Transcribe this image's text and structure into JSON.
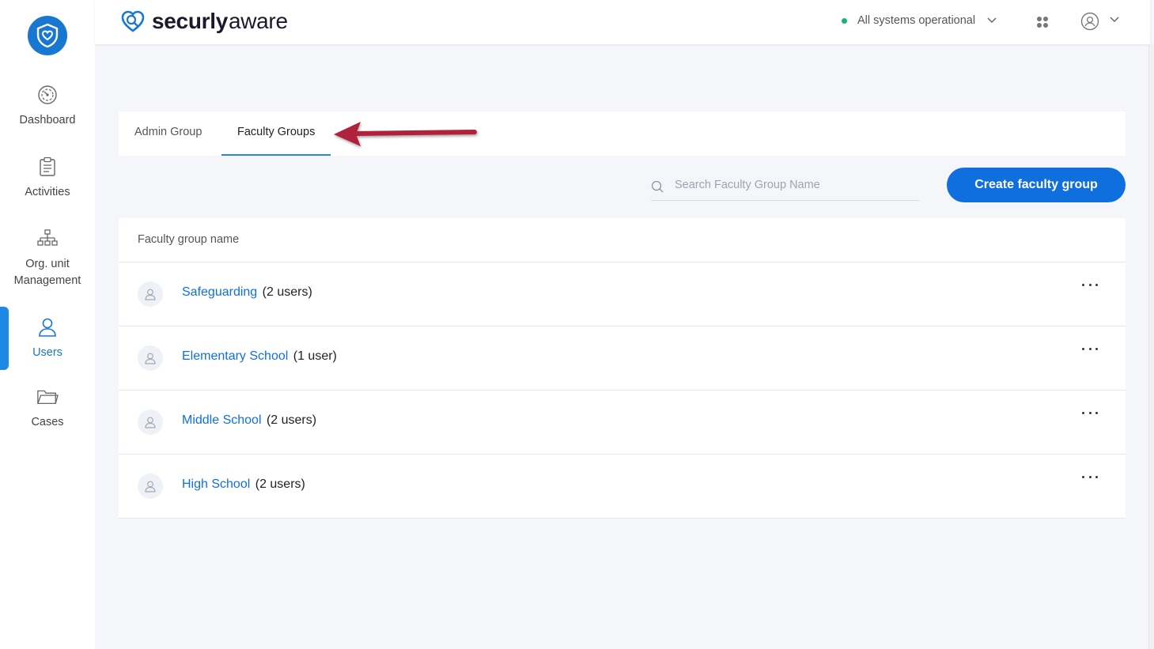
{
  "brand": {
    "name_bold": "securly",
    "name_light": "aware"
  },
  "header": {
    "status_text": "All systems operational",
    "status_color": "#19b27b"
  },
  "sidebar": {
    "items": [
      {
        "label": "Dashboard",
        "icon": "dashboard-gauge-icon"
      },
      {
        "label": "Activities",
        "icon": "clipboard-icon"
      },
      {
        "label": "Org. unit\nManagement",
        "icon": "org-chart-icon"
      },
      {
        "label": "Users",
        "icon": "user-icon",
        "active": true
      },
      {
        "label": "Cases",
        "icon": "folder-icon"
      }
    ]
  },
  "tabs": [
    {
      "label": "Admin Group",
      "active": false
    },
    {
      "label": "Faculty Groups",
      "active": true
    }
  ],
  "search": {
    "placeholder": "Search Faculty Group Name",
    "value": ""
  },
  "create_button": {
    "label": "Create faculty group"
  },
  "table": {
    "header": "Faculty group name",
    "rows": [
      {
        "name": "Safeguarding",
        "count": "(2 users)"
      },
      {
        "name": "Elementary School",
        "count": "(1 user)"
      },
      {
        "name": "Middle School",
        "count": "(2 users)"
      },
      {
        "name": "High School",
        "count": "(2 users)"
      }
    ]
  },
  "colors": {
    "accent": "#0f6fde",
    "sidebar_active": "#1e88e5",
    "annotation_arrow": "#b0213a"
  }
}
